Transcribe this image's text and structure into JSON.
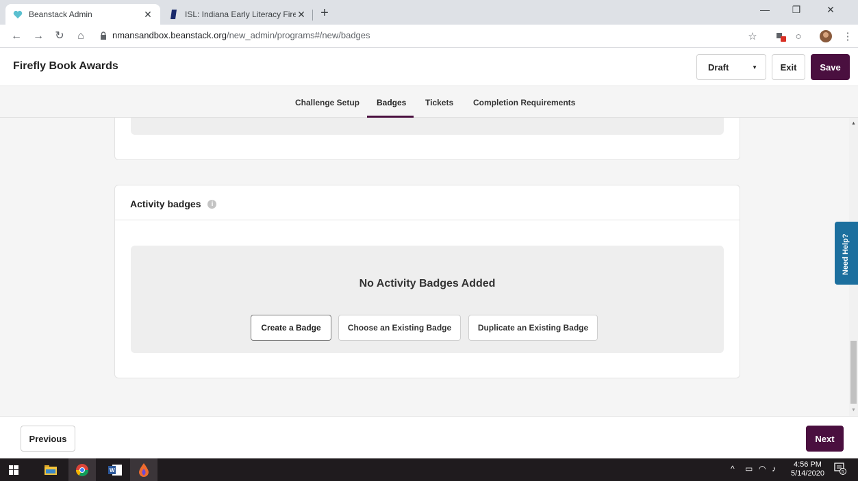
{
  "browser": {
    "tabs": [
      {
        "title": "Beanstack Admin",
        "icon": "heart-favicon",
        "active": true
      },
      {
        "title": "ISL: Indiana Early Literacy Firefly /",
        "icon": "bookmark-favicon",
        "active": false
      }
    ],
    "url_host": "nmansandbox.beanstack.org",
    "url_path": "/new_admin/programs#/new/badges"
  },
  "header": {
    "title": "Firefly Book Awards",
    "status_select": "Draft",
    "exit_label": "Exit",
    "save_label": "Save"
  },
  "subnav": {
    "tabs": [
      {
        "label": "Challenge Setup",
        "active": false
      },
      {
        "label": "Badges",
        "active": true
      },
      {
        "label": "Tickets",
        "active": false
      },
      {
        "label": "Completion Requirements",
        "active": false
      }
    ]
  },
  "activity_badges": {
    "title": "Activity badges",
    "empty_title": "No Activity Badges Added",
    "buttons": [
      "Create a Badge",
      "Choose an Existing Badge",
      "Duplicate an Existing Badge"
    ]
  },
  "help_tab": "Need Help?",
  "footer": {
    "previous_label": "Previous",
    "next_label": "Next"
  },
  "taskbar": {
    "time": "4:56 PM",
    "date": "5/14/2020",
    "notification_count": "5"
  },
  "colors": {
    "brand": "#4a0f3f",
    "help": "#1c6f9e"
  }
}
